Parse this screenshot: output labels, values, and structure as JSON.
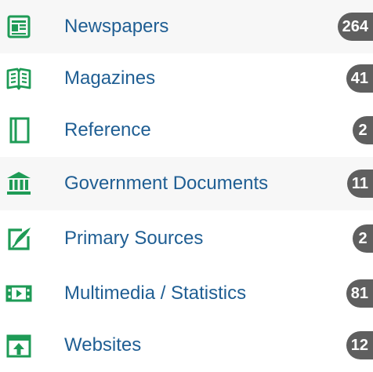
{
  "colors": {
    "icon": "#1e9b56",
    "label": "#1f5e93",
    "badge": "#5f5f5f",
    "badge_text": "#ffffff",
    "row_shade": "#f7f7f7"
  },
  "categories": [
    {
      "label": "Newspapers",
      "count": "264",
      "icon": "newspaper-icon"
    },
    {
      "label": "Magazines",
      "count": "41",
      "icon": "open-book-icon"
    },
    {
      "label": "Reference",
      "count": "2",
      "icon": "book-icon"
    },
    {
      "label": "Government Documents",
      "count": "11",
      "icon": "government-building-icon"
    },
    {
      "label": "Primary Sources",
      "count": "2",
      "icon": "quill-edit-icon"
    },
    {
      "label": "Multimedia / Statistics",
      "count": "81",
      "icon": "film-play-icon"
    },
    {
      "label": "Websites",
      "count": "12",
      "icon": "upload-window-icon"
    }
  ]
}
